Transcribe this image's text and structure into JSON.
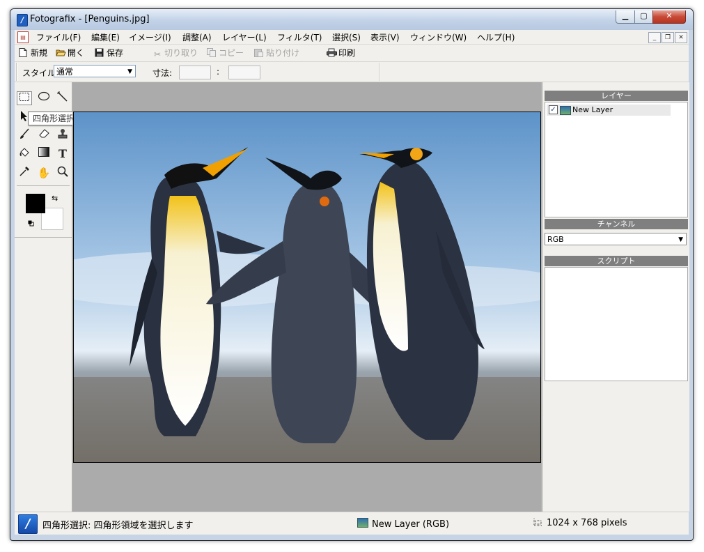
{
  "window": {
    "title": "Fotografix - [Penguins.jpg]"
  },
  "menubar": {
    "items": [
      "ファイル(F)",
      "編集(E)",
      "イメージ(I)",
      "調整(A)",
      "レイヤー(L)",
      "フィルタ(T)",
      "選択(S)",
      "表示(V)",
      "ウィンドウ(W)",
      "ヘルプ(H)"
    ]
  },
  "toolbar": {
    "new": "新規",
    "open": "開く",
    "save": "保存",
    "cut": "切り取り",
    "copy": "コピー",
    "paste": "貼り付け",
    "print": "印刷"
  },
  "options_bar": {
    "style_label": "スタイル:",
    "style_value": "通常",
    "size_label": "寸法:",
    "size_separator": ":"
  },
  "tools": {
    "tooltip": "四角形選択 (S)",
    "text_tool_glyph": "T"
  },
  "panels": {
    "layers": {
      "title": "レイヤー",
      "items": [
        {
          "name": "New Layer",
          "visible": true
        }
      ]
    },
    "channels": {
      "title": "チャンネル",
      "selected": "RGB"
    },
    "scripts": {
      "title": "スクリプト"
    }
  },
  "statusbar": {
    "message": "四角形選択: 四角形領域を選択します",
    "layer": "New Layer (RGB)",
    "size": "1024 x 768 pixels"
  },
  "colors": {
    "foreground": "#000000",
    "background": "#ffffff"
  }
}
